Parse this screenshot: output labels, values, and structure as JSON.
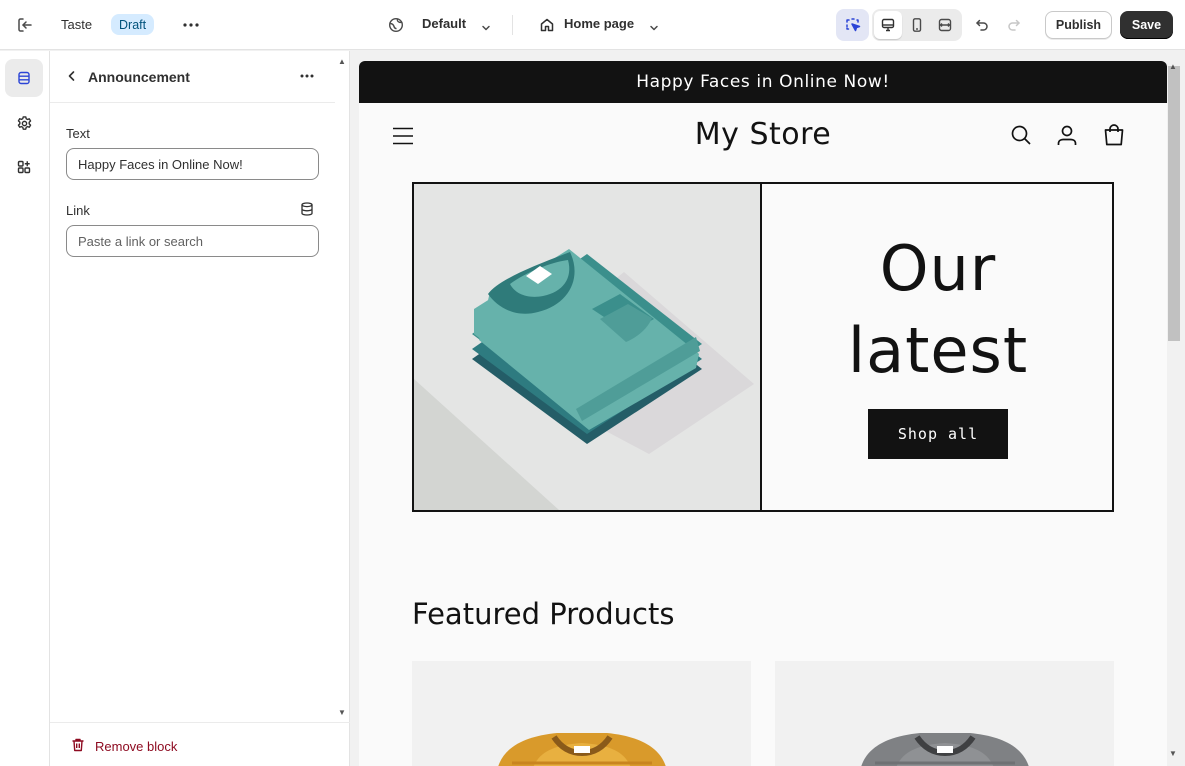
{
  "topbar": {
    "theme_name": "Taste",
    "status_badge": "Draft",
    "locale_selector": "Default",
    "page_selector": "Home page",
    "publish_label": "Publish",
    "save_label": "Save"
  },
  "rail": {
    "items": [
      "sections-icon",
      "settings-icon",
      "apps-icon"
    ]
  },
  "panel": {
    "title": "Announcement",
    "fields": {
      "text_label": "Text",
      "text_value": "Happy Faces in Online Now!",
      "link_label": "Link",
      "link_placeholder": "Paste a link or search"
    },
    "remove_label": "Remove block"
  },
  "preview": {
    "announcement": "Happy Faces in Online Now!",
    "store_name": "My Store",
    "hero": {
      "heading_line1": "Our",
      "heading_line2": "latest",
      "button_label": "Shop all"
    },
    "featured_title": "Featured Products"
  },
  "colors": {
    "accent_badge_bg": "#d5ebff",
    "save_bg": "#303030",
    "remove_red": "#8e0b21",
    "announcement_bg": "#121212"
  }
}
